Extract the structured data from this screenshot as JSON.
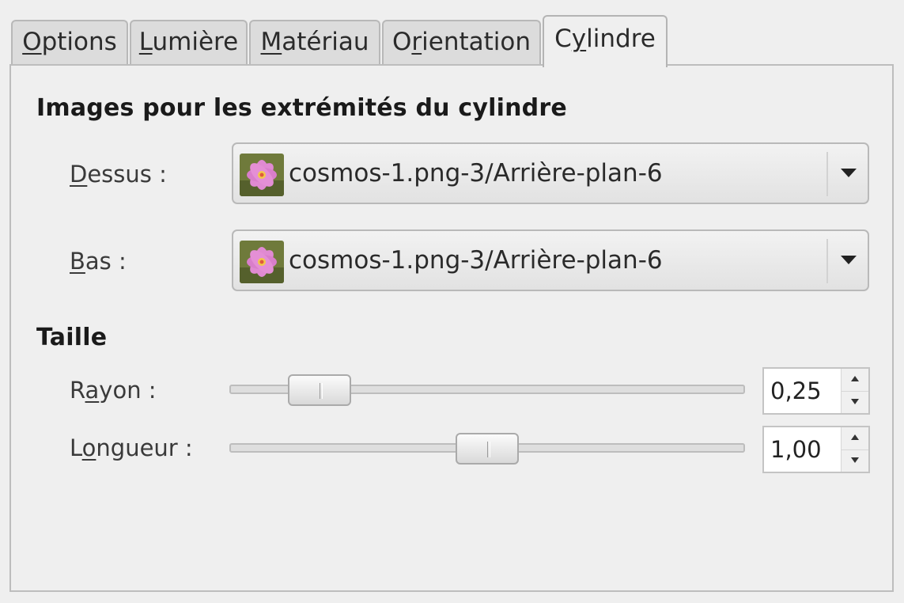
{
  "tabs": [
    {
      "pre": "",
      "mnemonic": "O",
      "post": "ptions"
    },
    {
      "pre": "",
      "mnemonic": "L",
      "post": "umière"
    },
    {
      "pre": "",
      "mnemonic": "M",
      "post": "atériau"
    },
    {
      "pre": "O",
      "mnemonic": "r",
      "post": "ientation"
    },
    {
      "pre": "C",
      "mnemonic": "y",
      "post": "lindre"
    }
  ],
  "active_tab": "Cylindre",
  "cylinder_ends": {
    "title": "Images pour les extrémités du cylindre",
    "top": {
      "label_mnemonic": "D",
      "label_rest": "essus :",
      "value": "cosmos-1.png-3/Arrière-plan-6"
    },
    "bottom": {
      "label_mnemonic": "B",
      "label_rest": "as :",
      "value": "cosmos-1.png-3/Arrière-plan-6"
    }
  },
  "size": {
    "title": "Taille",
    "radius": {
      "label_pre": "R",
      "label_mnemonic": "a",
      "label_post": "yon :",
      "value": "0,25",
      "slider_fraction": 0.13
    },
    "length": {
      "label_pre": "L",
      "label_mnemonic": "o",
      "label_post": "ngueur :",
      "value": "1,00",
      "slider_fraction": 0.5
    }
  },
  "icons": {
    "thumbnail": "flower-thumbnail-icon",
    "dropdown": "chevron-down-icon",
    "spin_up": "spin-up-icon",
    "spin_down": "spin-down-icon"
  }
}
